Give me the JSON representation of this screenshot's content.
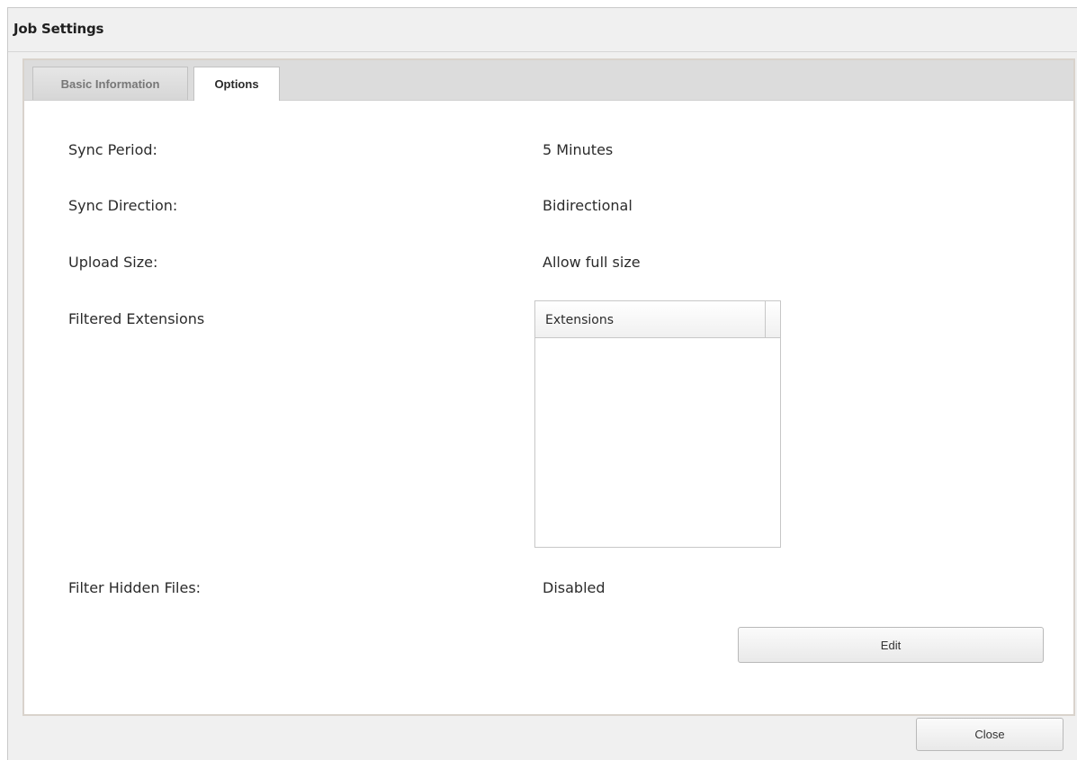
{
  "window": {
    "title": "Job Settings"
  },
  "tabs": [
    {
      "label": "Basic Information",
      "active": false
    },
    {
      "label": "Options",
      "active": true
    }
  ],
  "settings": {
    "sync_period": {
      "label": "Sync Period:",
      "value": "5 Minutes"
    },
    "sync_direction": {
      "label": "Sync Direction:",
      "value": "Bidirectional"
    },
    "upload_size": {
      "label": "Upload Size:",
      "value": "Allow full size"
    },
    "filtered_extensions": {
      "label": "Filtered Extensions",
      "column_header": "Extensions",
      "items": []
    },
    "filter_hidden_files": {
      "label": "Filter Hidden Files:",
      "value": "Disabled"
    }
  },
  "buttons": {
    "edit": "Edit",
    "close": "Close"
  }
}
